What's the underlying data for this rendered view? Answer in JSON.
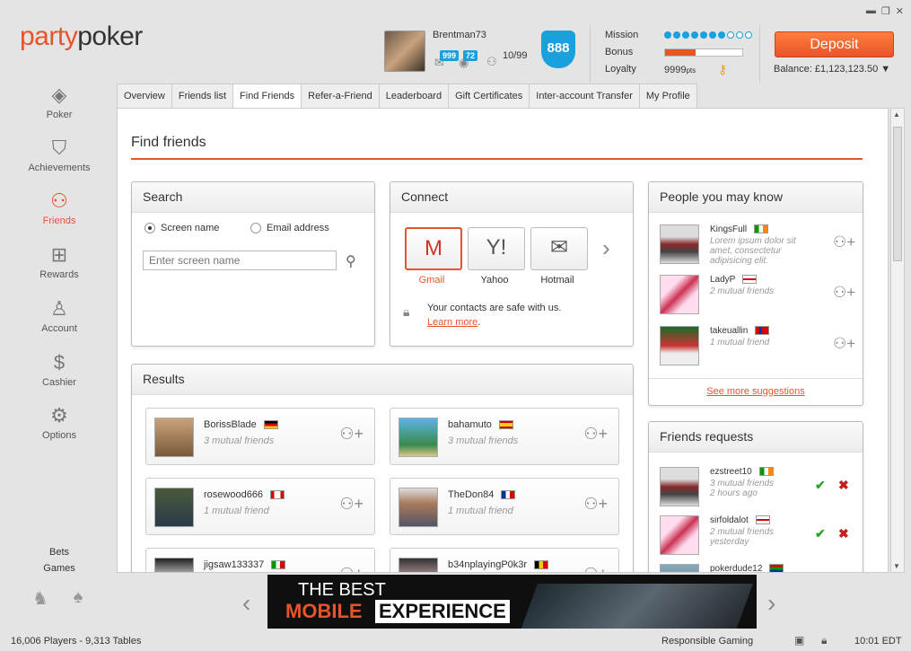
{
  "brand": {
    "party": "party",
    "poker": "poker"
  },
  "user": {
    "name": "Brentman73",
    "mail_count": "999",
    "friends_count": "72",
    "friends_online": "10/99",
    "level": "888"
  },
  "stats": {
    "mission_label": "Mission",
    "mission_progress": 0.7,
    "bonus_label": "Bonus",
    "bonus_progress": 0.4,
    "loyalty_label": "Loyalty",
    "loyalty_value": "9999",
    "loyalty_unit": "pts"
  },
  "deposit_label": "Deposit",
  "balance": "Balance: £1,123,123.50 ▼",
  "nav": [
    {
      "label": "Poker",
      "icon": "poker-card-icon"
    },
    {
      "label": "Achievements",
      "icon": "shield-icon"
    },
    {
      "label": "Friends",
      "icon": "friends-icon"
    },
    {
      "label": "Rewards",
      "icon": "gift-icon"
    },
    {
      "label": "Account",
      "icon": "user-icon"
    },
    {
      "label": "Cashier",
      "icon": "dollar-icon"
    },
    {
      "label": "Options",
      "icon": "wrench-icon"
    }
  ],
  "bottom_links": {
    "bets": "Bets",
    "games": "Games"
  },
  "tabs": [
    "Overview",
    "Friends list",
    "Find Friends",
    "Refer-a-Friend",
    "Leaderboard",
    "Gift Certificates",
    "Inter-account Transfer",
    "My Profile"
  ],
  "page_title": "Find friends",
  "search": {
    "title": "Search",
    "opt_screen": "Screen name",
    "opt_email": "Email address",
    "placeholder": "Enter screen name"
  },
  "connect": {
    "title": "Connect",
    "providers": [
      "Gmail",
      "Yahoo",
      "Hotmail"
    ],
    "safe_text": "Your contacts are safe with us.",
    "learn_more": "Learn more"
  },
  "results": {
    "title": "Results",
    "items": [
      {
        "name": "BorissBlade",
        "sub": "3 mutual friends",
        "flag": "de"
      },
      {
        "name": "bahamuto",
        "sub": "3 mutual friends",
        "flag": "es"
      },
      {
        "name": "rosewood666",
        "sub": "1 mutual friend",
        "flag": "ca"
      },
      {
        "name": "TheDon84",
        "sub": "1 mutual friend",
        "flag": "fr"
      },
      {
        "name": "jigsaw133337",
        "sub": "",
        "flag": "it"
      },
      {
        "name": "b34nplayingP0k3r",
        "sub": "",
        "flag": "be"
      }
    ]
  },
  "people": {
    "title": "People you may know",
    "items": [
      {
        "name": "KingsFull",
        "sub": "Lorem ipsum dolor sit amet, consectetur adipisicing elit.",
        "flag": "ie"
      },
      {
        "name": "LadyP",
        "sub": "2 mutual friends",
        "flag": "en"
      },
      {
        "name": "takeuallin",
        "sub": "1 mutual friend",
        "flag": "no"
      }
    ],
    "see_more": "See more suggestions"
  },
  "requests": {
    "title": "Friends requests",
    "items": [
      {
        "name": "ezstreet10",
        "sub1": "3 mutual friends",
        "sub2": "2 hours ago",
        "flag": "ie"
      },
      {
        "name": "sirfoldalot",
        "sub1": "2 mutual friends",
        "sub2": "yesterday",
        "flag": "en"
      },
      {
        "name": "pokerdude12",
        "sub1": "",
        "sub2": "",
        "flag": "za"
      }
    ]
  },
  "banner": {
    "line1": "THE BEST",
    "line2a": "MOBILE",
    "line2b": "EXPERIENCE"
  },
  "status": {
    "players": "16,006 Players - 9,313 Tables",
    "responsible": "Responsible Gaming",
    "time": "10:01 EDT"
  }
}
